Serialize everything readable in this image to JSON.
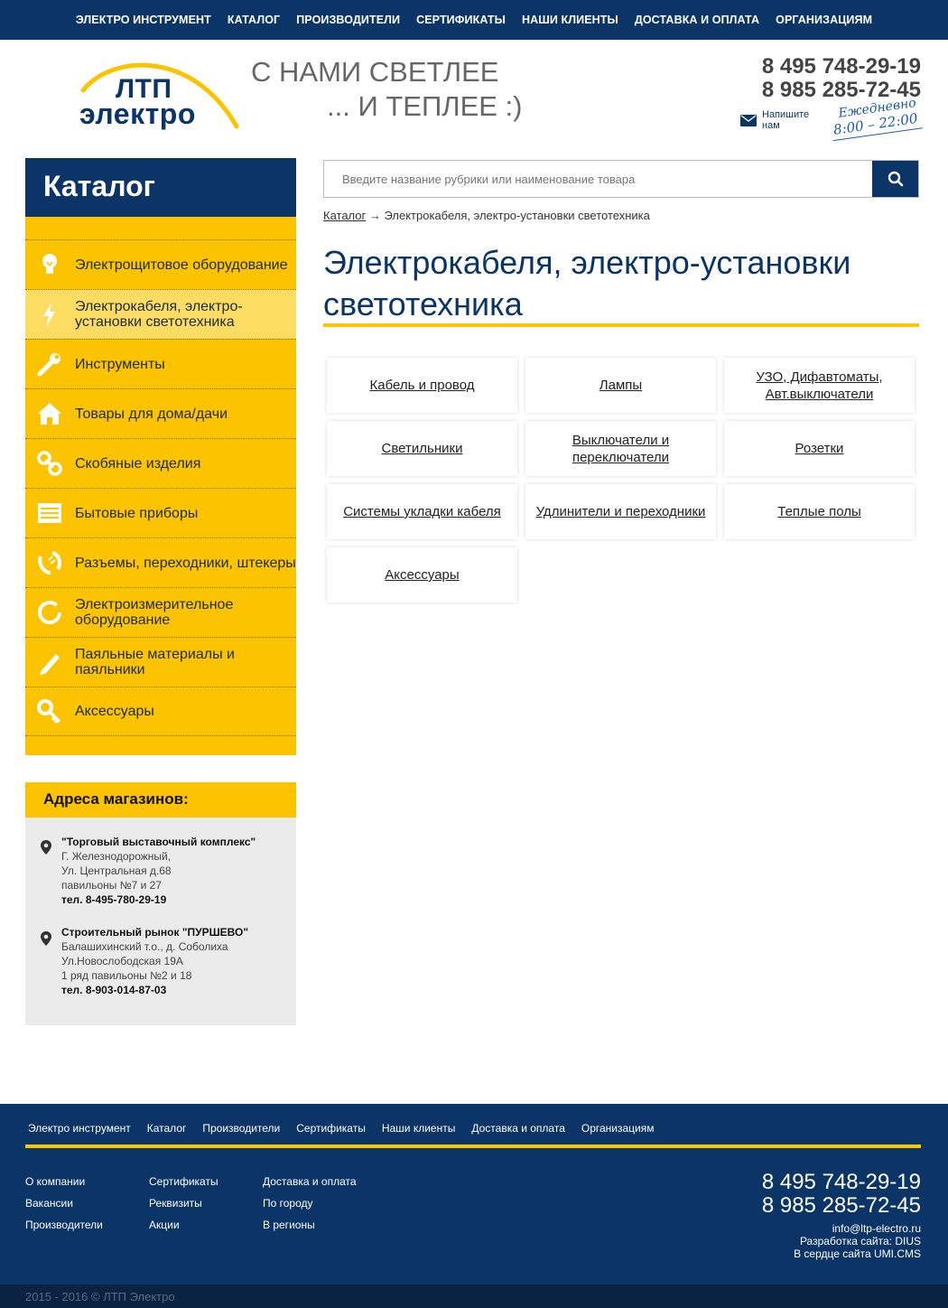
{
  "topnav": {
    "items": [
      "ЭЛЕКТРО ИНСТРУМЕНТ",
      "КАТАЛОГ",
      "ПРОИЗВОДИТЕЛИ",
      "СЕРТИФИКАТЫ",
      "НАШИ КЛИЕНТЫ",
      "ДОСТАВКА И ОПЛАТА",
      "ОРГАНИЗАЦИЯМ"
    ]
  },
  "header": {
    "logo_line1": "ЛТП",
    "logo_line2": "электро",
    "slogan_line1": "С НАМИ СВЕТЛЕЕ",
    "slogan_line2": "... И ТЕПЛЕЕ :)",
    "phone1": "8 495 748-29-19",
    "phone2": "8 985 285-72-45",
    "write_us": "Напишите нам",
    "daily_label": "Ежедневно",
    "daily_hours": "8:00 – 22:00"
  },
  "sidebar": {
    "catalog_title": "Каталог",
    "items": [
      {
        "label": "Электрощитовое оборудование",
        "icon": "bulb-icon"
      },
      {
        "label": "Электрокабеля, электро-установки светотехника",
        "icon": "lightning-icon",
        "active": true
      },
      {
        "label": "Инструменты",
        "icon": "wrench-icon"
      },
      {
        "label": "Товары для дома/дачи",
        "icon": "house-icon"
      },
      {
        "label": "Скобяные изделия",
        "icon": "chain-icon"
      },
      {
        "label": "Бытовые приборы",
        "icon": "appliance-icon"
      },
      {
        "label": "Разъемы, переходники, штекеры",
        "icon": "connector-icon"
      },
      {
        "label": "Электроизмерительное оборудование",
        "icon": "gauge-icon"
      },
      {
        "label": "Паяльные материалы и паяльники",
        "icon": "pencil-icon"
      },
      {
        "label": "Аксессуары",
        "icon": "key-icon"
      }
    ],
    "stores_title": "Адреса магазинов:",
    "stores": [
      {
        "name": "\"Торговый выставочный комплекс\"",
        "lines": [
          "Г. Железнодорожный,",
          "Ул. Центральная д.68",
          "павильоны №7 и 27"
        ],
        "tel": "тел. 8-495-780-29-19"
      },
      {
        "name": "Строительный рынок \"ПУРШЕВО\"",
        "lines": [
          "Балашихинский т.о., д. Соболиха",
          "Ул.Новослободская 19А",
          "1 ряд павильоны №2 и 18"
        ],
        "tel": "тел. 8-903-014-87-03"
      }
    ]
  },
  "search": {
    "placeholder": "Введите название рубрики или наименование товара"
  },
  "breadcrumb": {
    "root": "Каталог",
    "separator": " → ",
    "current": "Электрокабеля, электро-установки светотехника"
  },
  "main": {
    "title": "Электрокабеля, электро-установки светотехника",
    "categories": [
      "Кабель и провод",
      "Лампы",
      "УЗО, Дифавтоматы, Авт.выключатели",
      "Светильники",
      "Выключатели и переключатели",
      "Розетки",
      "Системы укладки кабеля",
      "Удлинители и переходники",
      "Теплые полы",
      "Аксессуары"
    ]
  },
  "footer": {
    "nav": [
      "Электро инструмент",
      "Каталог",
      "Производители",
      "Сертификаты",
      "Наши клиенты",
      "Доставка и оплата",
      "Организациям"
    ],
    "col1": [
      "О компании",
      "Вакансии",
      "Производители"
    ],
    "col2": [
      "Сертификаты",
      "Реквизиты",
      "Акции"
    ],
    "col3": [
      "Доставка и оплата",
      "По городу",
      "В регионы"
    ],
    "phone1": "8 495 748-29-19",
    "phone2": "8 985 285-72-45",
    "email": "info@ltp-electro.ru",
    "dev": "Разработка сайта: DIUS",
    "cms": "В сердце сайта UMI.CMS",
    "copyright": "2015 - 2016 © ЛТП Электро"
  },
  "colors": {
    "brand_blue": "#0a3566",
    "brand_yellow": "#fcc400",
    "store_bg": "#ebebeb"
  }
}
